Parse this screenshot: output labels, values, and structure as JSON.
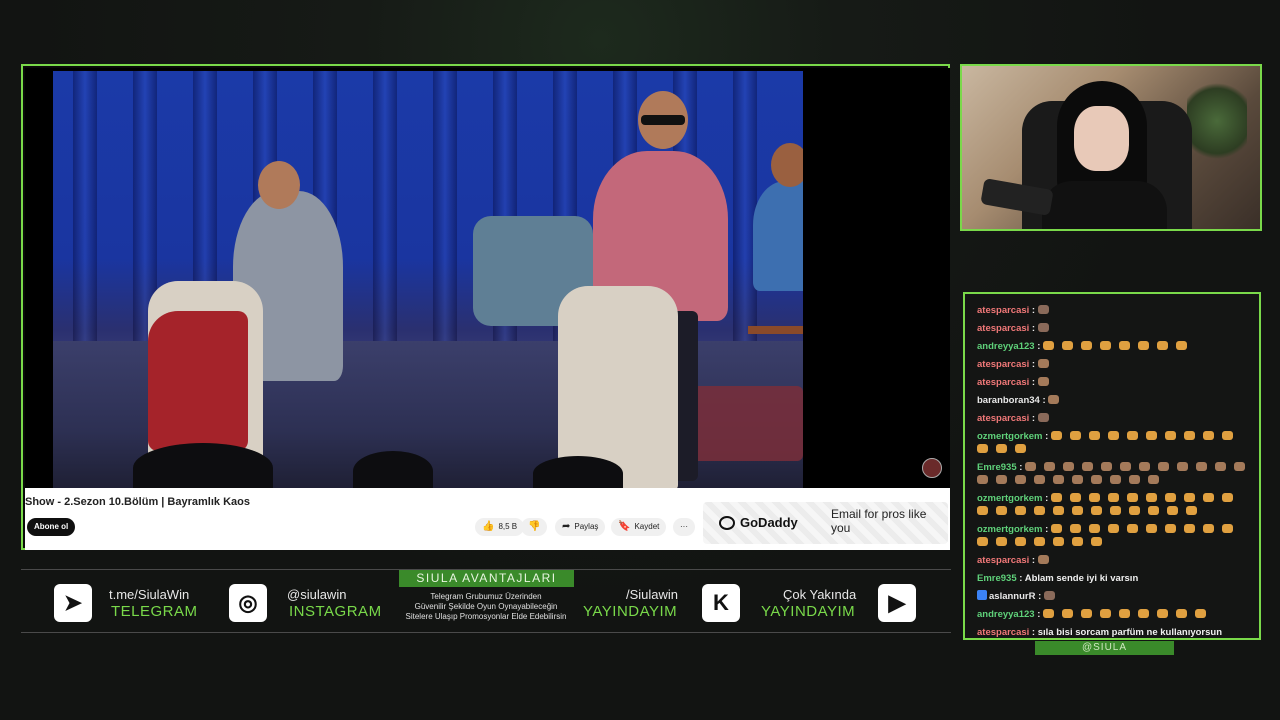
{
  "video": {
    "title": "Show - 2.Sezon 10.Bölüm | Bayramlık Kaos",
    "subscribe_label": "Abone ol",
    "likes": "8,5 B",
    "share_label": "Paylaş",
    "save_label": "Kaydet",
    "more_label": "···",
    "ad": {
      "brand": "GoDaddy",
      "text": "Email for pros like you"
    }
  },
  "chat": {
    "handle": "@SIULA",
    "messages": [
      {
        "user": "atesparcasi",
        "color": "#f07878",
        "text": "",
        "emotes": [
          "dark"
        ]
      },
      {
        "user": "atesparcasi",
        "color": "#f07878",
        "text": "",
        "emotes": [
          "dark"
        ]
      },
      {
        "user": "andreyya123",
        "color": "#5fd17a",
        "text": "",
        "emotes": [
          "gold",
          "gold",
          "gold",
          "gold",
          "gold",
          "gold",
          "gold",
          "gold"
        ]
      },
      {
        "user": "atesparcasi",
        "color": "#f07878",
        "text": "",
        "emotes": [
          "mix"
        ]
      },
      {
        "user": "atesparcasi",
        "color": "#f07878",
        "text": "",
        "emotes": [
          "mix"
        ]
      },
      {
        "user": "baranboran34",
        "color": "#e8e8e8",
        "text": "",
        "emotes": [
          "mix"
        ]
      },
      {
        "user": "atesparcasi",
        "color": "#f07878",
        "text": "",
        "emotes": [
          "dark"
        ]
      },
      {
        "user": "ozmertgorkem",
        "color": "#5fd17a",
        "text": "",
        "emotes": [
          "gold",
          "gold",
          "gold",
          "gold",
          "gold",
          "gold",
          "gold",
          "gold",
          "gold",
          "gold",
          "gold",
          "gold",
          "gold"
        ]
      },
      {
        "user": "Emre935",
        "color": "#5fd17a",
        "text": "",
        "emotes": [
          "mix",
          "mix",
          "mix",
          "mix",
          "mix",
          "mix",
          "mix",
          "mix",
          "mix",
          "mix",
          "mix",
          "mix",
          "mix",
          "mix",
          "mix",
          "mix",
          "mix",
          "mix",
          "mix",
          "mix",
          "mix",
          "mix"
        ]
      },
      {
        "user": "ozmertgorkem",
        "color": "#5fd17a",
        "text": "",
        "emotes": [
          "gold",
          "gold",
          "gold",
          "gold",
          "gold",
          "gold",
          "gold",
          "gold",
          "gold",
          "gold",
          "gold",
          "gold",
          "gold",
          "gold",
          "gold",
          "gold",
          "gold",
          "gold",
          "gold",
          "gold",
          "gold",
          "gold"
        ]
      },
      {
        "user": "ozmertgorkem",
        "color": "#5fd17a",
        "text": "",
        "emotes": [
          "gold",
          "gold",
          "gold",
          "gold",
          "gold",
          "gold",
          "gold",
          "gold",
          "gold",
          "gold",
          "gold",
          "gold",
          "gold",
          "gold",
          "gold",
          "gold",
          "gold"
        ]
      },
      {
        "user": "atesparcasi",
        "color": "#f07878",
        "text": "",
        "emotes": [
          "mix"
        ]
      },
      {
        "user": "Emre935",
        "color": "#5fd17a",
        "text": "Ablam sende iyi ki varsın",
        "emotes": []
      },
      {
        "user": "aslannurR",
        "color": "#e8e8e8",
        "text": "",
        "emotes": [
          "dark"
        ],
        "badge": true
      },
      {
        "user": "andreyya123",
        "color": "#5fd17a",
        "text": "",
        "emotes": [
          "gold",
          "gold",
          "gold",
          "gold",
          "gold",
          "gold",
          "gold",
          "gold",
          "gold"
        ]
      },
      {
        "user": "atesparcasi",
        "color": "#f07878",
        "text": "sıla bisi sorcam parfüm ne kullanıyorsun",
        "emotes": []
      }
    ]
  },
  "bottom_bar": {
    "telegram": {
      "top": "t.me/SiulaWin",
      "bottom": "TELEGRAM"
    },
    "instagram": {
      "top": "@siulawin",
      "bottom": "INSTAGRAM"
    },
    "promo": {
      "title": "SIULA AVANTAJLARI",
      "lines": [
        "Telegram Grubumuz Üzerinden",
        "Güvenilir Şekilde Oyun Oynayabileceğin",
        "Sitelere Ulaşıp Promosyonlar Elde Edebilirsin"
      ]
    },
    "kick": {
      "top": "/Siulawin",
      "bottom": "YAYINDAYIM"
    },
    "youtube": {
      "top": "Çok Yakında",
      "bottom": "YAYINDAYIM"
    }
  },
  "colors": {
    "accent": "#7ad94a",
    "brand_green": "#3a8a2a"
  }
}
